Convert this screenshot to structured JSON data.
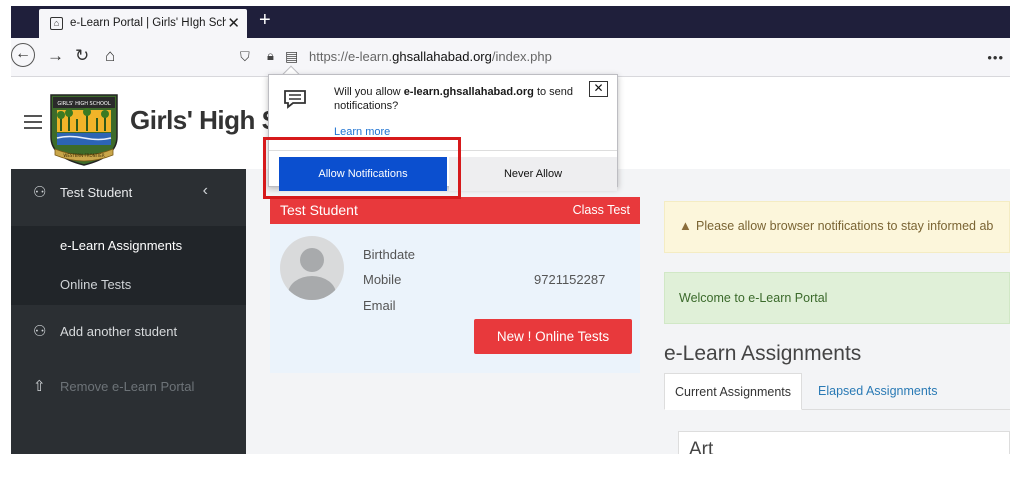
{
  "browser": {
    "tab_title": "e-Learn Portal | Girls' HIgh Scho",
    "tab_close": "✕",
    "new_tab": "+",
    "url_host": "https://e-learn.",
    "url_domain": "ghsallahabad.org",
    "url_path": "/index.php",
    "more": "•••"
  },
  "site": {
    "title": "Girls' High Sch",
    "logo_top": "GIRLS' HIGH SCHOOL",
    "logo_bottom": "WESTERN FRONTIER"
  },
  "notification_popup": {
    "message_prefix": "Will you allow ",
    "message_domain": "e-learn.ghsallahabad.org",
    "message_suffix": " to send notifications?",
    "learn_more": "Learn more",
    "allow_label": "Allow Notifications",
    "never_label": "Never Allow",
    "close_label": "✕"
  },
  "sidebar": {
    "student_name": "Test Student",
    "chevron": "‹",
    "items": [
      {
        "label": "e-Learn Assignments"
      },
      {
        "label": "Online Tests"
      },
      {
        "label": "Add another student"
      },
      {
        "label": "Remove e-Learn Portal"
      }
    ]
  },
  "student_card": {
    "name": "Test Student",
    "class": "Class Test",
    "fields": [
      {
        "label": "Birthdate",
        "value": ""
      },
      {
        "label": "Mobile",
        "value": "9721152287"
      },
      {
        "label": "Email",
        "value": ""
      }
    ],
    "button_label": "New ! Online Tests"
  },
  "alerts": {
    "warning": "Please allow browser notifications to stay informed ab",
    "welcome": "Welcome to e-Learn Portal"
  },
  "assignments": {
    "title": "e-Learn Assignments",
    "tabs": [
      {
        "label": "Current Assignments"
      },
      {
        "label": "Elapsed Assignments"
      }
    ],
    "subject": "Art"
  },
  "colors": {
    "sidebar_bg": "#2b2f33",
    "accent_red": "#e8393c",
    "allow_blue": "#0b4fcf",
    "highlight": "#d6191b"
  }
}
